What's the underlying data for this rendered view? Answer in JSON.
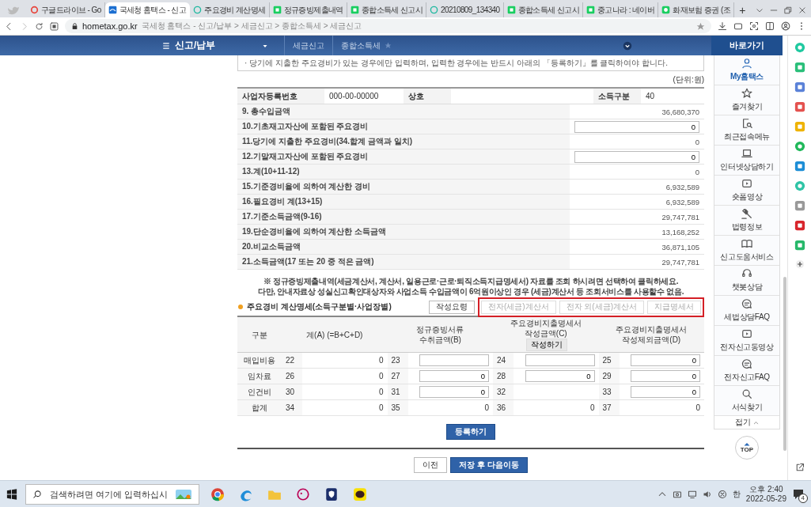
{
  "browser": {
    "tabs": [
      {
        "title": "구글드라이브 - Go",
        "selected": false
      },
      {
        "title": "국세청 홈택스 - 신고",
        "selected": true
      },
      {
        "title": "주요경비 계산명세",
        "selected": false
      },
      {
        "title": "정규증빙제출내역",
        "selected": false
      },
      {
        "title": "종합소득세 신고시",
        "selected": false
      },
      {
        "title": "20210809_134340",
        "selected": false
      },
      {
        "title": "종합소득세 신고시",
        "selected": false
      },
      {
        "title": "중고나라 : 네이버",
        "selected": false
      },
      {
        "title": "화재보험 증권 (조",
        "selected": false
      }
    ],
    "new_tab": "+",
    "address": {
      "domain": "hometax.go.kr",
      "title": "국세청 홈택스 - 신고/납부 > 세금신고 > 종합소득세 > 세금신고"
    }
  },
  "nav": {
    "menu": "신고/납부",
    "breadcrumbs": [
      "세금신고",
      "종합소득세"
    ]
  },
  "form": {
    "notice": "· 당기에 지출한 주요경비가 있는 경우에만 입력하며, 입력한 경우에는 반드시 아래의 「등록하기」를 클릭하여야 합니다.",
    "unit": "(단위:원)",
    "info": [
      {
        "label": "사업자등록번호",
        "value": "000-00-00000"
      },
      {
        "label": "상호"
      },
      {
        "label": "소득구분",
        "value": "40"
      }
    ],
    "rows": [
      {
        "kind": "text",
        "label": "9. 총수입금액",
        "value": "36,680,370"
      },
      {
        "kind": "input",
        "label": "10.기초재고자산에 포함된 주요경비",
        "value": "0"
      },
      {
        "kind": "text",
        "label": "11.당기에 지출한 주요경비(34.합계 금액과 일치)",
        "value": "0"
      },
      {
        "kind": "input",
        "label": "12.기말재고자산에 포함된 주요경비",
        "value": "0"
      },
      {
        "kind": "text",
        "label": "13.계(10+11-12)",
        "value": "0"
      },
      {
        "kind": "text",
        "label": "15.기준경비율에 의하여 계산한 경비",
        "value": "6,932,589"
      },
      {
        "kind": "text",
        "label": "16.필요경비 계(13+15)",
        "value": "6,932,589"
      },
      {
        "kind": "text",
        "label": "17.기준소득금액(9-16)",
        "value": "29,747,781"
      },
      {
        "kind": "text",
        "label": "19.단순경비율에 의하여 계산한 소득금액",
        "value": "13,168,252"
      },
      {
        "kind": "text",
        "label": "20.비교소득금액",
        "value": "36,871,105"
      },
      {
        "kind": "text",
        "label": "21.소득금액(17 또는 20 중 적은 금액)",
        "value": "29,747,781"
      }
    ],
    "guide": [
      "※ 정규증빙제출내역(세금계산서, 계산서, 일용근로·근로·퇴직소득지급명세서) 자료를 조회 하시려면 선택하여 클릭하세요.",
      "다만, 안내자료상 성실신고확인대상자와 사업소득 수입금액이 6억원이상인 경우 (세금)계산서 등 조회서비스를 사용할수 없음."
    ],
    "section": {
      "title": "주요경비 계산명세(소득구분별·사업장별)",
      "guide_button": "작성요령",
      "highlighted": true,
      "source_buttons": [
        {
          "label": "전자(세금)계산서",
          "disabled": true
        },
        {
          "label": "전자 외(세금)계산서",
          "disabled": true
        },
        {
          "label": "지급명세서",
          "disabled": true
        }
      ]
    },
    "table": {
      "columns": [
        {
          "label": "구분"
        },
        {
          "label": "계(A) (=B+C+D)"
        },
        {
          "label": "정규증빙서류 수취금액(B)"
        },
        {
          "label": "주요경비지출명세서 작성금액(C)",
          "button": "작성하기"
        },
        {
          "label": "주요경비지출명세서 작성제외금액(D)"
        }
      ],
      "rows": [
        {
          "cells": [
            {
              "kind": "label",
              "value": "매입비용"
            },
            {
              "number": "22",
              "kind": "text",
              "value": "0"
            },
            {
              "number": "23",
              "kind": "input"
            },
            {
              "number": "24",
              "kind": "input"
            },
            {
              "number": "25",
              "kind": "input",
              "value": "0"
            }
          ]
        },
        {
          "cells": [
            {
              "kind": "label",
              "value": "임차료"
            },
            {
              "number": "26",
              "kind": "text",
              "value": "0"
            },
            {
              "number": "27",
              "kind": "input",
              "value": "0"
            },
            {
              "number": "28",
              "kind": "input",
              "value": "0"
            },
            {
              "number": "29",
              "kind": "input",
              "value": "0"
            }
          ]
        },
        {
          "cells": [
            {
              "kind": "label",
              "value": "인건비"
            },
            {
              "number": "30",
              "kind": "text",
              "value": "0"
            },
            {
              "number": "31",
              "kind": "input",
              "value": "0"
            },
            {
              "number": "32",
              "kind": "empty"
            },
            {
              "number": "33",
              "kind": "input",
              "value": "0"
            }
          ]
        },
        {
          "cells": [
            {
              "kind": "label",
              "value": "합계"
            },
            {
              "number": "34",
              "kind": "text",
              "value": "0"
            },
            {
              "number": "35",
              "kind": "text",
              "value": "0"
            },
            {
              "number": "36",
              "kind": "text",
              "value": "0"
            },
            {
              "number": "37",
              "kind": "text",
              "value": "0"
            }
          ]
        }
      ]
    },
    "register": "등록하기",
    "prev": "이전",
    "next": "저장 후 다음이동"
  },
  "quick_menu": {
    "title": "바로가기",
    "items": [
      {
        "label": "My홈택스",
        "selected": true
      },
      {
        "label": "즐겨찾기",
        "selected": false
      },
      {
        "label": "최근접속메뉴",
        "selected": false
      },
      {
        "label": "인터넷상담하기",
        "selected": false
      },
      {
        "label": "숏폼영상",
        "selected": false
      },
      {
        "label": "법령정보",
        "selected": false
      },
      {
        "label": "신고도움서비스",
        "selected": false
      },
      {
        "label": "챗봇상담",
        "selected": false
      },
      {
        "label": "세법상담FAQ",
        "selected": false
      },
      {
        "label": "전자신고동영상",
        "selected": false
      },
      {
        "label": "전자신고FAQ",
        "selected": false
      },
      {
        "label": "서식찾기",
        "selected": false
      }
    ],
    "collapse": "접기",
    "top": "TOP"
  },
  "taskbar": {
    "search_placeholder": "검색하려면 여기에 입력하십시",
    "ime": "한",
    "time": "오후 2:40",
    "date": "2022-05-29",
    "notifications": "4"
  }
}
